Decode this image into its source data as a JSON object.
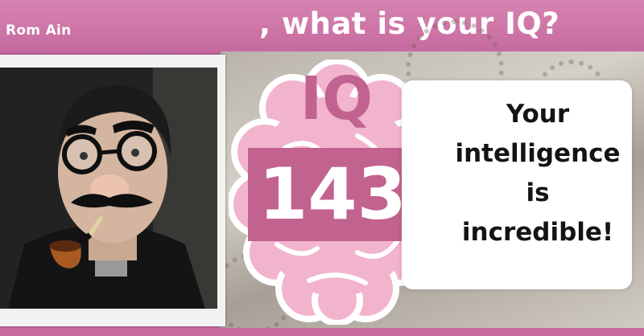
{
  "header": {
    "user_name": "Rom Ain",
    "question": ", what is your IQ?"
  },
  "result": {
    "iq_label": "IQ",
    "iq_score": "143",
    "message": "Your intelligence is incredible!"
  },
  "colors": {
    "brand_pink": "#c1628f",
    "brain_pink": "#f2b4cd",
    "card_white": "#ffffff"
  },
  "icons": [
    "brain-icon"
  ]
}
